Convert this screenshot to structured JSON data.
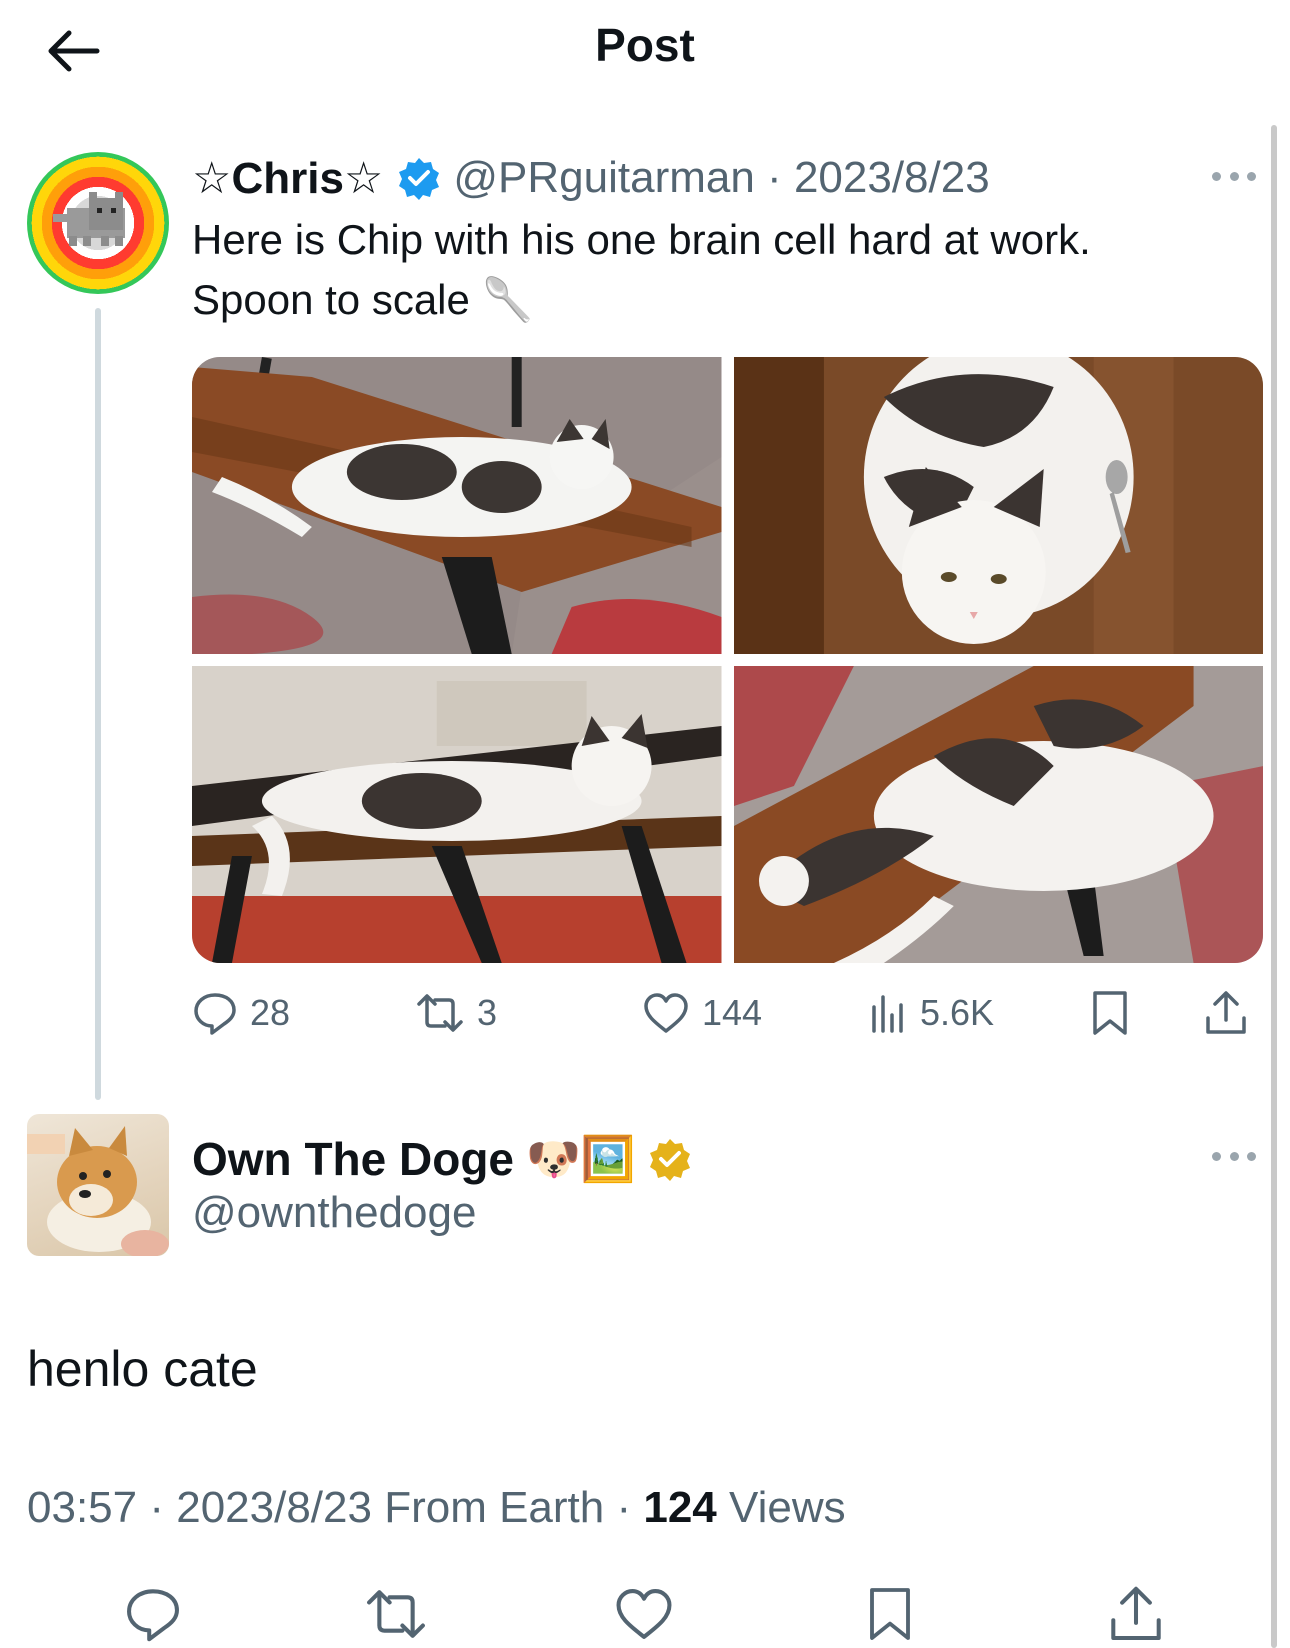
{
  "header": {
    "title": "Post",
    "back_icon": "arrow-left-icon"
  },
  "parent_post": {
    "display_name": "☆Chris☆",
    "verified_badge": "blue-verified-icon",
    "handle": "@PRguitarman",
    "date": "2023/8/23",
    "text_line1": "Here is Chip with his one brain cell hard at work.",
    "text_line2": "Spoon to scale 🥄",
    "photos": [
      "cat-on-bench-photo",
      "cat-with-spoon-photo",
      "cat-on-table-photo",
      "cat-lying-photo"
    ],
    "stats": {
      "replies": "28",
      "reposts": "3",
      "likes": "144",
      "views": "5.6K"
    }
  },
  "post": {
    "display_name": "Own The Doge",
    "name_emojis": "🐶🖼️",
    "verified_badge": "gold-verified-icon",
    "handle": "@ownthedoge",
    "text": "henlo cate",
    "time": "03:57",
    "date": "2023/8/23",
    "source": "From Earth",
    "views_count": "124",
    "views_label": "Views"
  },
  "colors": {
    "accent": "#1d9bf0",
    "muted": "#536471",
    "gold": "#e5b21a"
  }
}
